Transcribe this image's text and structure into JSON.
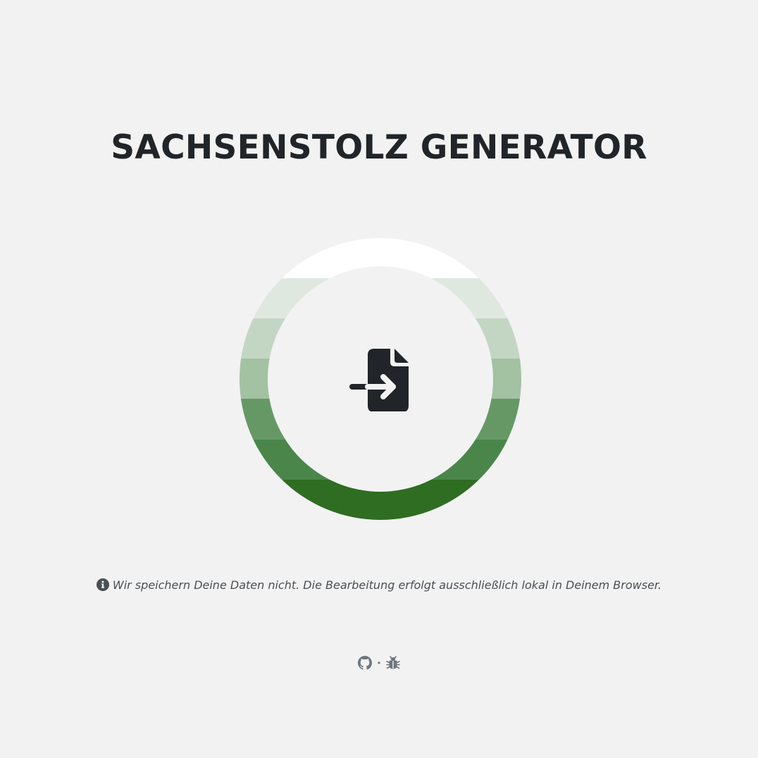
{
  "header": {
    "title": "SACHSENSTOLZ GENERATOR"
  },
  "upload": {
    "icon": "file-import-icon",
    "stripe_colors": [
      "#ffffff",
      "#dfe8df",
      "#c3d6c3",
      "#a2c2a2",
      "#669866",
      "#4a864a",
      "#2e6d22"
    ]
  },
  "notice": {
    "icon": "info-circle-icon",
    "text": "Wir speichern Deine Daten nicht. Die Bearbeitung erfolgt ausschließlich lokal in Deinem Browser."
  },
  "footer": {
    "github_icon": "github-icon",
    "separator": "•",
    "bug_icon": "bug-icon"
  },
  "colors": {
    "background": "#f2f2f2",
    "text_dark": "#212529",
    "muted": "#6c757d"
  }
}
